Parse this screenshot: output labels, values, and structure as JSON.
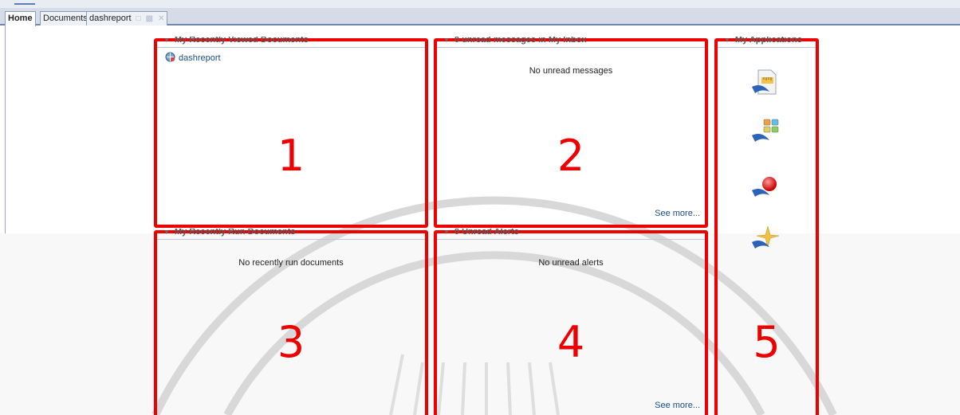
{
  "tabs": [
    {
      "label": "Home",
      "active": true
    },
    {
      "label": "Documents",
      "active": false
    },
    {
      "label": "dashreport",
      "active": false
    }
  ],
  "portlets": {
    "recently_viewed": {
      "title": "My Recently Viewed Documents",
      "link": "dashreport",
      "number": "1"
    },
    "inbox": {
      "title": "0 unread messages in My Inbox",
      "message": "No unread messages",
      "see_more": "See more...",
      "number": "2"
    },
    "recently_run": {
      "title": "My Recently Run Documents",
      "message": "No recently run documents",
      "number": "3"
    },
    "alerts": {
      "title": "0 Unread Alerts",
      "message": "No unread alerts",
      "see_more": "See more...",
      "number": "4"
    },
    "applications": {
      "title": "My Applications",
      "number": "5",
      "icons": [
        "report-app-icon",
        "dashboard-app-icon",
        "explorer-app-icon",
        "analysis-app-icon"
      ]
    }
  },
  "colors": {
    "highlight": "#ee0000",
    "link": "#1a4d8a",
    "tabbar": "#d6dce7"
  }
}
